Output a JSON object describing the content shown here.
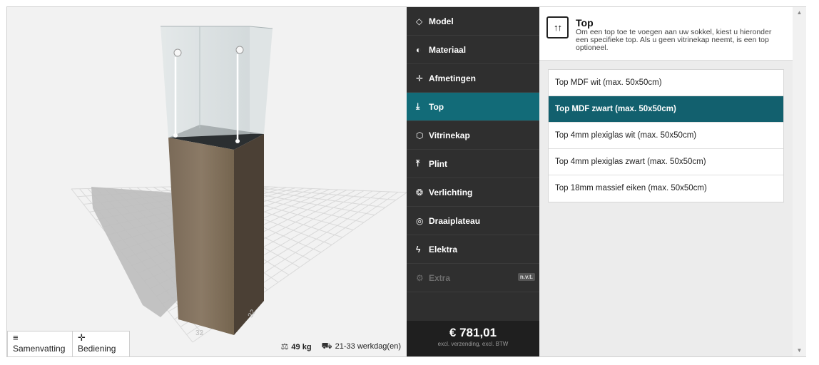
{
  "bottom_tabs": [
    {
      "icon": "menu-icon",
      "glyph": "≡",
      "label": "Samenvatting"
    },
    {
      "icon": "move-icon",
      "glyph": "✛",
      "label": "Bediening"
    }
  ],
  "info": {
    "weight": "49 kg",
    "delivery": "21-33 werkdag(en)"
  },
  "grid_labels": [
    "32",
    "32"
  ],
  "menu": [
    {
      "icon": "diamond-icon",
      "glyph": "◇",
      "label": "Model",
      "state": "normal"
    },
    {
      "icon": "half-circle-icon",
      "glyph": "◐",
      "label": "Materiaal",
      "state": "normal"
    },
    {
      "icon": "move-icon",
      "glyph": "✛",
      "label": "Afmetingen",
      "state": "normal"
    },
    {
      "icon": "arrow-down-bar-icon",
      "glyph": "⤓",
      "label": "Top",
      "state": "active"
    },
    {
      "icon": "cube-icon",
      "glyph": "⬡",
      "label": "Vitrinekap",
      "state": "normal"
    },
    {
      "icon": "arrow-up-bar-icon",
      "glyph": "⤒",
      "label": "Plint",
      "state": "normal"
    },
    {
      "icon": "bulb-icon",
      "glyph": "❂",
      "label": "Verlichting",
      "state": "normal"
    },
    {
      "icon": "target-icon",
      "glyph": "◎",
      "label": "Draaiplateau",
      "state": "normal"
    },
    {
      "icon": "bolt-icon",
      "glyph": "ϟ",
      "label": "Elektra",
      "state": "normal"
    },
    {
      "icon": "gear-icon",
      "glyph": "⚙",
      "label": "Extra",
      "state": "disabled",
      "badge": "n.v.t."
    }
  ],
  "price": {
    "amount": "€ 781,01",
    "note": "excl. verzending, excl. BTW"
  },
  "panel": {
    "icon": "top-arrows-icon",
    "glyph": "↑↑",
    "title": "Top",
    "description": "Om een top toe te voegen aan uw sokkel, kiest u hieronder een specifieke top. Als u geen vitrinekap neemt, is een top optioneel.",
    "options": [
      {
        "label": "Top MDF wit (max. 50x50cm)",
        "selected": false
      },
      {
        "label": "Top MDF zwart (max. 50x50cm)",
        "selected": true
      },
      {
        "label": "Top 4mm plexiglas wit (max. 50x50cm)",
        "selected": false
      },
      {
        "label": "Top 4mm plexiglas zwart (max. 50x50cm)",
        "selected": false
      },
      {
        "label": "Top 18mm massief eiken (max. 50x50cm)",
        "selected": false
      }
    ]
  },
  "colors": {
    "accent": "#126b78",
    "menu_bg": "#2f2f2f",
    "selected": "#12606e"
  }
}
